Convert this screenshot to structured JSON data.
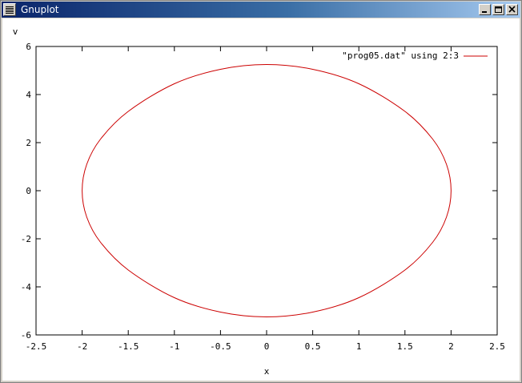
{
  "window": {
    "title": "Gnuplot",
    "icons": {
      "system_menu": "window-menu-icon",
      "minimize": "minimize-icon",
      "maximize": "maximize-icon",
      "close": "close-icon"
    }
  },
  "chart_data": {
    "type": "line",
    "title": "",
    "xlabel": "x",
    "ylabel": "v",
    "xlim": [
      -2.5,
      2.5
    ],
    "ylim": [
      -6,
      6
    ],
    "x_ticks": [
      "-2.5",
      "-2",
      "-1.5",
      "-1",
      "-0.5",
      "0",
      "0.5",
      "1",
      "1.5",
      "2",
      "2.5"
    ],
    "y_ticks": [
      "-6",
      "-4",
      "-2",
      "0",
      "2",
      "4",
      "6"
    ],
    "grid": false,
    "legend": "top-right",
    "series": [
      {
        "name": "\"prog05.dat\" using 2:3",
        "color": "#cc0000",
        "x": [
          0,
          0.5,
          1,
          1.5,
          1.8,
          1.95,
          2.0,
          1.95,
          1.8,
          1.5,
          1,
          0.5,
          0,
          -0.5,
          -1,
          -1.5,
          -1.8,
          -1.95,
          -2.0,
          -1.95,
          -1.8,
          -1.5,
          -1,
          -0.5,
          0
        ],
        "y": [
          5.25,
          5.05,
          4.45,
          3.3,
          2.15,
          1.1,
          0,
          -1.1,
          -2.15,
          -3.3,
          -4.45,
          -5.05,
          -5.25,
          -5.05,
          -4.45,
          -3.3,
          -2.15,
          -1.1,
          0,
          1.1,
          2.15,
          3.3,
          4.45,
          5.05,
          5.25
        ]
      }
    ]
  }
}
